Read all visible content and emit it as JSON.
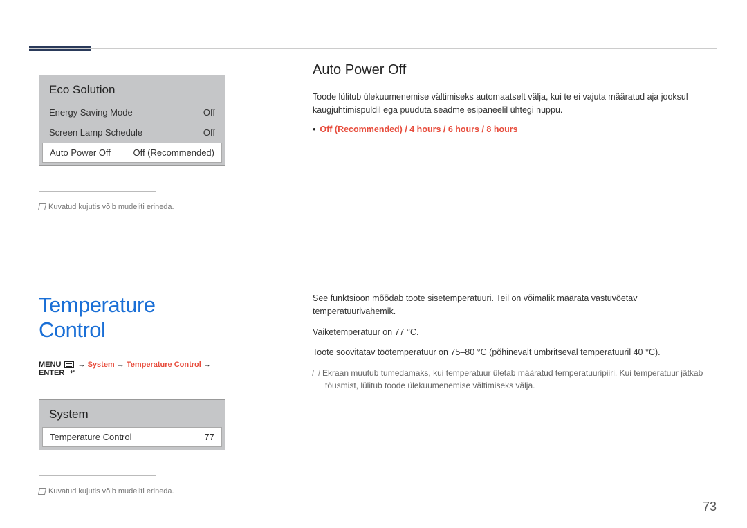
{
  "eco_box": {
    "title": "Eco Solution",
    "rows": [
      {
        "label": "Energy Saving Mode",
        "value": "Off"
      },
      {
        "label": "Screen Lamp Schedule",
        "value": "Off"
      },
      {
        "label": "Auto Power Off",
        "value": "Off (Recommended)"
      }
    ]
  },
  "note_disclaimer": "Kuvatud kujutis võib mudeliti erineda.",
  "temp_heading": "Temperature Control",
  "menu_path": {
    "prefix": "MENU",
    "arrow": "→",
    "system": "System",
    "temp": "Temperature Control",
    "enter": "ENTER"
  },
  "system_box": {
    "title": "System",
    "row": {
      "label": "Temperature Control",
      "value": "77"
    }
  },
  "apo": {
    "heading": "Auto Power Off",
    "body": "Toode lülitub ülekuumenemise vältimiseks automaatselt välja, kui te ei vajuta määratud aja jooksul kaugjuhtimispuldil ega puuduta seadme esipaneelil ühtegi nuppu.",
    "options": "Off (Recommended) / 4 hours / 6 hours / 8 hours"
  },
  "temp_desc": {
    "p1": "See funktsioon mõõdab toote sisetemperatuuri. Teil on võimalik määrata vastuvõetav temperatuurivahemik.",
    "p2": "Vaiketemperatuur on 77 °C.",
    "p3": "Toote soovitatav töötemperatuur on 75–80 °C (põhinevalt ümbritseval temperatuuril 40 °C).",
    "note": "Ekraan muutub tumedamaks, kui temperatuur ületab määratud temperatuuripiiri. Kui temperatuur jätkab tõusmist, lülitub toode ülekuumenemise vältimiseks välja."
  },
  "page": "73"
}
